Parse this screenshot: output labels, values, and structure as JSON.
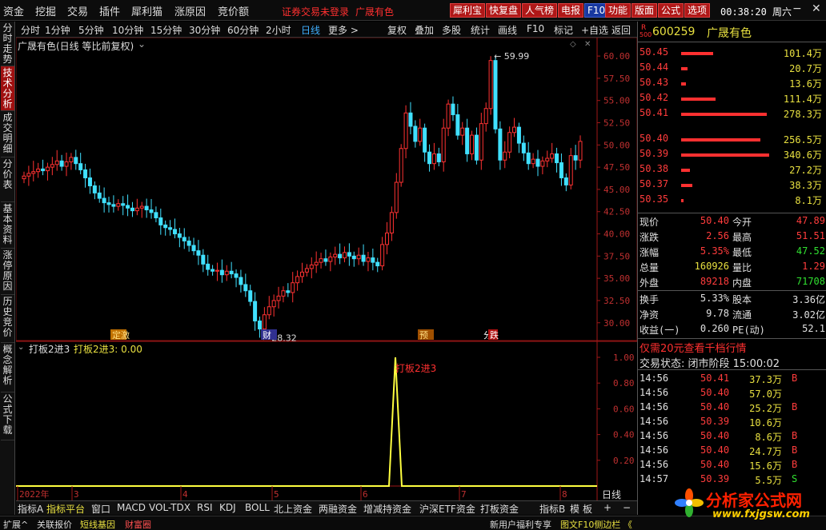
{
  "menu": {
    "items": [
      "资金",
      "挖掘",
      "交易",
      "插件",
      "犀利猫",
      "涨原因",
      "竞价额"
    ],
    "alert": "证券交易未登录",
    "stock_name": "广晟有色",
    "buttons": [
      "犀利宝",
      "快复盘",
      "人气榜",
      "电报",
      "F10",
      "功能",
      "版面",
      "公式",
      "选项"
    ],
    "time": "00:38:20 周六"
  },
  "leftbar": {
    "tabs": [
      "分时走势",
      "技术分析",
      "成交明细",
      "分价表",
      "基本资料",
      "涨停原因",
      "历史竞价",
      "概念解析",
      "公式下载"
    ]
  },
  "periodbar": {
    "periods": [
      "分时",
      "1分钟",
      "5分钟",
      "10分钟",
      "15分钟",
      "30分钟",
      "60分钟",
      "2小时",
      "日线",
      "更多 >"
    ],
    "tools": [
      "复权",
      "叠加",
      "多股",
      "统计",
      "画线",
      "F10",
      "标记",
      "+自选",
      "返回"
    ]
  },
  "main_title": "广晟有色(日线 等比前复权)",
  "chart_data": [
    {
      "type": "candlestick",
      "title": "广晟有色(日线 等比前复权)",
      "ylim": [
        28,
        61
      ],
      "yticks": [
        30,
        32.5,
        35,
        37.5,
        40,
        42.5,
        45,
        47.5,
        50,
        52.5,
        55,
        57.5,
        60
      ],
      "ytick_labels": [
        "30.00",
        "32.50",
        "35.00",
        "37.50",
        "40.00",
        "42.50",
        "45.00",
        "47.50",
        "50.00",
        "52.50",
        "55.00",
        "57.50",
        "60.00"
      ],
      "x_labels": [
        "2022年",
        "3",
        "4",
        "5",
        "6",
        "7",
        "8"
      ],
      "annotations": [
        {
          "text": "59.99",
          "value": 59.99
        },
        {
          "text": "28.32",
          "value": 28.32
        }
      ],
      "event_markers": [
        "定激",
        "财",
        "预",
        "分",
        "跌"
      ],
      "close": [
        46.5,
        46.8,
        47.0,
        47.3,
        47.1,
        47.5,
        47.8,
        48.2,
        47.6,
        48.1,
        48.6,
        47.9,
        47.2,
        46.3,
        45.4,
        44.6,
        44.0,
        43.5,
        43.3,
        43.1,
        43.4,
        43.2,
        42.9,
        42.6,
        42.9,
        43.1,
        42.7,
        42.4,
        41.8,
        41.0,
        40.7,
        40.5,
        40.0,
        39.6,
        39.2,
        38.7,
        38.1,
        37.6,
        36.6,
        36.0,
        35.8,
        35.9,
        35.4,
        35.8,
        35.5,
        35.1,
        34.3,
        33.6,
        32.4,
        30.2,
        29.3,
        30.9,
        31.8,
        32.5,
        33.0,
        33.6,
        33.4,
        34.5,
        35.2,
        35.7,
        36.1,
        36.5,
        36.8,
        37.2,
        36.9,
        37.4,
        37.7,
        37.3,
        37.9,
        37.5,
        37.2,
        37.6,
        36.9,
        37.3,
        36.8,
        36.4,
        38.8,
        40.1,
        42.4,
        45.8,
        49.6,
        53.6,
        52.1,
        50.4,
        51.9,
        49.2,
        47.9,
        49.0,
        48.1,
        51.9,
        54.6,
        53.4,
        51.1,
        51.9,
        49.0,
        51.1,
        48.3,
        52.4,
        54.1,
        59.5,
        51.8,
        48.3,
        49.2,
        51.4,
        52.0,
        50.2,
        49.1,
        47.9,
        48.4,
        47.6,
        48.2,
        48.5,
        49.0,
        48.0,
        46.3,
        45.5,
        48.8,
        48.3,
        50.4
      ],
      "lows": [
        28.32
      ],
      "highs": [
        59.99
      ]
    },
    {
      "type": "line",
      "title": "打板2进3",
      "legend": "打板2进3: 0.00",
      "ylim": [
        0,
        1
      ],
      "yticks": [
        0.2,
        0.4,
        0.6,
        0.8,
        1.0
      ],
      "ytick_labels": [
        "0.20",
        "0.40",
        "0.60",
        "0.80",
        "1.00"
      ],
      "x": [
        "2022年",
        "3",
        "4",
        "5",
        "6",
        "7",
        "8"
      ],
      "series": [
        {
          "name": "打板2进3",
          "peak_value": 1.0,
          "peak_label": "打板2进3"
        }
      ]
    }
  ],
  "sub_title": "打板2进3",
  "sub_legend": "打板2进3: 0.00",
  "sub_annot": "打板2进3",
  "period_label": "日线",
  "quote": {
    "code_prefix": "R",
    "code_prefix2": "500",
    "code": "600259",
    "name": "广晟有色",
    "asks": [
      {
        "price": "50.45",
        "vol": "101.4万",
        "bar": 0.36
      },
      {
        "price": "50.44",
        "vol": "20.7万",
        "bar": 0.07
      },
      {
        "price": "50.43",
        "vol": "13.6万",
        "bar": 0.05
      },
      {
        "price": "50.42",
        "vol": "111.4万",
        "bar": 0.39
      },
      {
        "price": "50.41",
        "vol": "278.3万",
        "bar": 0.97
      }
    ],
    "bids": [
      {
        "price": "50.40",
        "vol": "256.5万",
        "bar": 0.9
      },
      {
        "price": "50.39",
        "vol": "340.6万",
        "bar": 1.0
      },
      {
        "price": "50.38",
        "vol": "27.2万",
        "bar": 0.1
      },
      {
        "price": "50.37",
        "vol": "38.3万",
        "bar": 0.13
      },
      {
        "price": "50.35",
        "vol": "8.1万",
        "bar": 0.03
      }
    ],
    "stats": [
      {
        "l1": "现价",
        "v1": "50.40",
        "l2": "今开",
        "v2": "47.89"
      },
      {
        "l1": "涨跌",
        "v1": "2.56",
        "l2": "最高",
        "v2": "51.51"
      },
      {
        "l1": "涨幅",
        "v1": "5.35%",
        "l2": "最低",
        "v2": "47.52"
      },
      {
        "l1": "总量",
        "v1": "160926",
        "l2": "量比",
        "v2": "1.29"
      },
      {
        "l1": "外盘",
        "v1": "89218",
        "l2": "内盘",
        "v2": "71708"
      }
    ],
    "stats2": [
      {
        "l1": "换手",
        "v1": "5.33%",
        "l2": "股本",
        "v2": "3.36亿"
      },
      {
        "l1": "净资",
        "v1": "9.78",
        "l2": "流通",
        "v2": "3.02亿"
      },
      {
        "l1": "收益(一)",
        "v1": "0.260",
        "l2": "PE(动)",
        "v2": "52.1"
      }
    ],
    "promo": "仅需20元查看千档行情",
    "trade_status": "交易状态: 闭市阶段 15:00:02",
    "ticks": [
      {
        "t": "14:56",
        "p": "50.41",
        "v": "37.3万",
        "s": "B"
      },
      {
        "t": "14:56",
        "p": "50.40",
        "v": "57.0万",
        "s": ""
      },
      {
        "t": "14:56",
        "p": "50.40",
        "v": "25.2万",
        "s": "B"
      },
      {
        "t": "14:56",
        "p": "50.39",
        "v": "10.6万",
        "s": ""
      },
      {
        "t": "14:56",
        "p": "50.40",
        "v": "8.6万",
        "s": "B"
      },
      {
        "t": "14:56",
        "p": "50.40",
        "v": "24.7万",
        "s": "B"
      },
      {
        "t": "14:56",
        "p": "50.40",
        "v": "15.6万",
        "s": "B"
      },
      {
        "t": "14:57",
        "p": "50.39",
        "v": "5.5万",
        "s": "S"
      }
    ]
  },
  "bottombar": {
    "tabs": [
      "指标A",
      "指标平台",
      "窗口",
      "MACD",
      "VOL-TDX",
      "RSI",
      "KDJ",
      "BOLL",
      "北上资金",
      "两融资金",
      "增减持资金",
      "沪深ETF资金",
      "打板资金",
      "指标B",
      "模",
      "板",
      "+",
      "−"
    ]
  },
  "statusbar": {
    "items": [
      "扩展^",
      "关联报价",
      "短线基因",
      "财富圈",
      "新用户福利专享",
      "图文F10侧边栏 《"
    ]
  },
  "watermark": {
    "cn": "分析家公式网",
    "url": "www.fxjgsw.com"
  },
  "colors": {
    "up": "#ff3232",
    "down": "#40e0ff",
    "sub_line": "#ffff40"
  }
}
